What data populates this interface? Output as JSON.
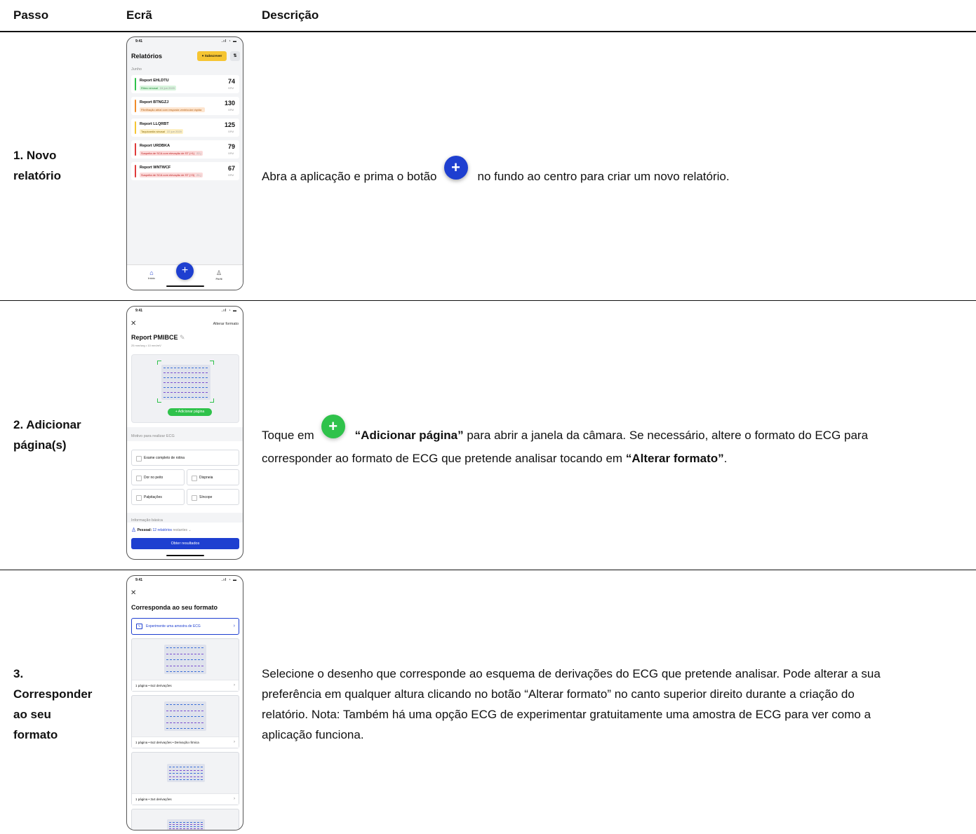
{
  "headers": {
    "step": "Passo",
    "screen": "Ecrã",
    "description": "Descrição"
  },
  "rows": [
    {
      "step_line1": "1. Novo",
      "step_line2": "relatório",
      "desc_before": "Abra a aplicação e prima o botão",
      "desc_icon": "plus-icon",
      "desc_after": "no fundo ao centro para criar um novo relatório.",
      "phone": {
        "time": "9:41",
        "title": "Relatórios",
        "subscribe": "Subscrever",
        "month": "Junho",
        "reports": [
          {
            "name": "Report EHLDTU",
            "tag": "Ritmo sinusal",
            "date": "24 jun 2020",
            "bpm": "74",
            "color": "#2fc24b",
            "tag_bg": "#d7f4dc",
            "tag_fg": "#1f8a35"
          },
          {
            "name": "Report BTNGZJ",
            "tag": "Fibrilhação atrial com resposta ventricular rápida",
            "date": "",
            "bpm": "130",
            "color": "#f08c2a",
            "tag_bg": "#fde5cf",
            "tag_fg": "#b45f12"
          },
          {
            "name": "Report LLQRBT",
            "tag": "Taquicardia sinusal",
            "date": "22 jun 2020",
            "bpm": "125",
            "color": "#f6c533",
            "tag_bg": "#fdf0c4",
            "tag_fg": "#8a6a00"
          },
          {
            "name": "Report URDBKA",
            "tag": "Suspeita de SCA com elevação de ST (+1)",
            "date": "22 j",
            "bpm": "79",
            "color": "#e03a3a",
            "tag_bg": "#fbdada",
            "tag_fg": "#c02020"
          },
          {
            "name": "Report WNTWCF",
            "tag": "Suspeita de SCA com elevação de ST (+3)",
            "date": "21 j",
            "bpm": "67",
            "color": "#e03a3a",
            "tag_bg": "#fbdada",
            "tag_fg": "#c02020"
          }
        ],
        "bpm_unit": "BPM",
        "tab_home": "Início",
        "tab_profile": "Perfil"
      }
    },
    {
      "step_line1": "2. Adicionar",
      "step_line2": "página(s)",
      "desc_p1": "Toque em",
      "desc_bold1": "“Adicionar página”",
      "desc_p2": "para abrir a janela da câmara. Se necessário, altere o formato do ECG para",
      "desc_p3": "corresponder ao formato de ECG que pretende analisar tocando em",
      "desc_bold2": "“Alterar formato”",
      "desc_p4": ".",
      "phone": {
        "time": "9:41",
        "change_format": "Alterar formato",
        "title": "Report PMIBCE",
        "subtitle": "25 mm/seg • 10 mm/mV",
        "add_page": "+ Adicionar página",
        "reason_header": "Motivo para realizar ECG",
        "options": [
          "Exame completo de rotina",
          "Dor no peito",
          "Dispneia",
          "Palpitações",
          "Síncope"
        ],
        "basic_info": "Informação básica",
        "personal_label": "Pessoal:",
        "personal_link": "12 relatórios",
        "personal_rest": "restantes",
        "get_results": "Obter resultados"
      }
    },
    {
      "step_line1": "3.",
      "step_line2": "Corresponder",
      "step_line3": "ao seu",
      "step_line4": "formato",
      "desc_lines": [
        "Selecione o desenho que corresponde ao esquema de derivações do ECG que pretende analisar. Pode alterar a sua",
        "preferência em qualquer altura clicando no botão “Alterar formato” no canto superior direito durante a criação do",
        "relatório. Nota: Também há uma opção ECG de experimentar gratuitamente uma amostra de ECG para ver como a",
        "aplicação funciona."
      ],
      "phone": {
        "time": "9:41",
        "title": "Corresponda ao seu formato",
        "try_sample": "Experimente uma amostra de ECG",
        "formats": [
          "1 página • 6x2 derivações",
          "1 página • 6x2 derivações • Derivação rítmica",
          "1 página • 3x4 derivações"
        ]
      }
    }
  ],
  "colors": {
    "brand_blue": "#1e3fd0",
    "green": "#2fc24b"
  }
}
